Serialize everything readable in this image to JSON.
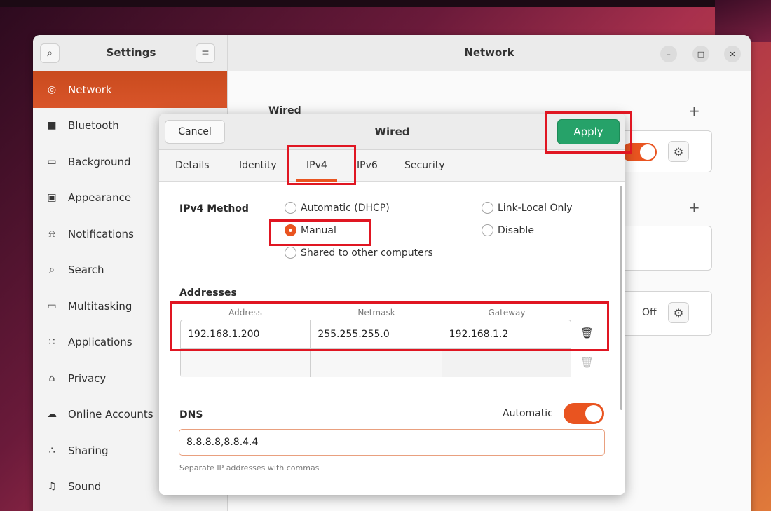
{
  "colors": {
    "accent": "#e95420",
    "apply": "#26a269",
    "annotation": "#e01622"
  },
  "settings": {
    "title": "Settings",
    "page_title": "Network",
    "sidebar": [
      {
        "label": "Network",
        "icon": "network-icon",
        "active": true
      },
      {
        "label": "Bluetooth",
        "icon": "bluetooth-icon"
      },
      {
        "label": "Background",
        "icon": "background-icon"
      },
      {
        "label": "Appearance",
        "icon": "appearance-icon"
      },
      {
        "label": "Notifications",
        "icon": "bell-icon"
      },
      {
        "label": "Search",
        "icon": "search-icon"
      },
      {
        "label": "Multitasking",
        "icon": "multitasking-icon"
      },
      {
        "label": "Applications",
        "icon": "grid-icon"
      },
      {
        "label": "Privacy",
        "icon": "lock-icon"
      },
      {
        "label": "Online Accounts",
        "icon": "cloud-icon"
      },
      {
        "label": "Sharing",
        "icon": "share-icon"
      },
      {
        "label": "Sound",
        "icon": "music-note-icon"
      }
    ],
    "background": {
      "wired_label": "Wired",
      "off_label": "Off"
    }
  },
  "dialog": {
    "title": "Wired",
    "cancel_label": "Cancel",
    "apply_label": "Apply",
    "tabs": [
      "Details",
      "Identity",
      "IPv4",
      "IPv6",
      "Security"
    ],
    "active_tab": "IPv4",
    "ipv4_method_label": "IPv4 Method",
    "methods": {
      "automatic": "Automatic (DHCP)",
      "link_local": "Link-Local Only",
      "manual": "Manual",
      "disable": "Disable",
      "shared": "Shared to other computers"
    },
    "selected_method": "Manual",
    "addresses_label": "Addresses",
    "columns": [
      "Address",
      "Netmask",
      "Gateway"
    ],
    "rows": [
      {
        "address": "192.168.1.200",
        "netmask": "255.255.255.0",
        "gateway": "192.168.1.2"
      },
      {
        "address": "",
        "netmask": "",
        "gateway": ""
      }
    ],
    "dns_label": "DNS",
    "dns_automatic_label": "Automatic",
    "dns_value": "8.8.8.8,8.8.4.4",
    "dns_hint": "Separate IP addresses with commas"
  }
}
